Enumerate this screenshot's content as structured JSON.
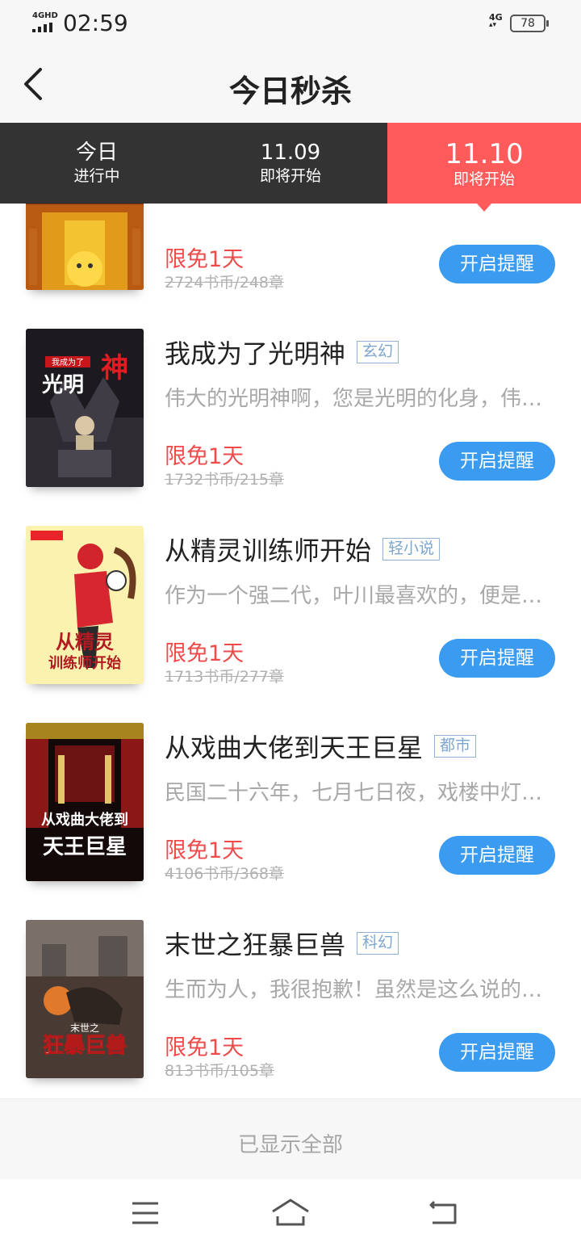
{
  "status_bar": {
    "network": "4GHD",
    "time": "02:59",
    "cellular": "4G",
    "battery": "78"
  },
  "header": {
    "title": "今日秒杀"
  },
  "tabs": [
    {
      "label": "今日",
      "sub": "进行中"
    },
    {
      "label": "11.09",
      "sub": "即将开始"
    },
    {
      "label": "11.10",
      "sub": "即将开始",
      "active": true
    }
  ],
  "books": [
    {
      "title": "",
      "genre": "",
      "desc": "",
      "free": "限免1天",
      "price": "2724书币/248章",
      "button": "开启提醒"
    },
    {
      "title": "我成为了光明神",
      "genre": "玄幻",
      "desc": "伟大的光明神啊，您是光明的化身，伟大的光明神啊",
      "free": "限免1天",
      "price": "1732书币/215章",
      "button": "开启提醒"
    },
    {
      "title": "从精灵训练师开始",
      "genre": "轻小说",
      "desc": "作为一个强二代，叶川最喜欢的，便是那些精灵",
      "free": "限免1天",
      "price": "1713书币/277章",
      "button": "开启提醒"
    },
    {
      "title": "从戏曲大佬到天王巨星",
      "genre": "都市",
      "desc": "民国二十六年，七月七日夜，戏楼中灯火通明",
      "free": "限免1天",
      "price": "4106书币/368章",
      "button": "开启提醒"
    },
    {
      "title": "末世之狂暴巨兽",
      "genre": "科幻",
      "desc": "生而为人，我很抱歉！虽然是这么说的，但是",
      "free": "限免1天",
      "price": "813书币/105章",
      "button": "开启提醒"
    }
  ],
  "footer": {
    "text": "已显示全部"
  },
  "colors": {
    "accent_red": "#ff5b5b",
    "button_blue": "#3b9bf0",
    "tab_bg": "#333333"
  }
}
